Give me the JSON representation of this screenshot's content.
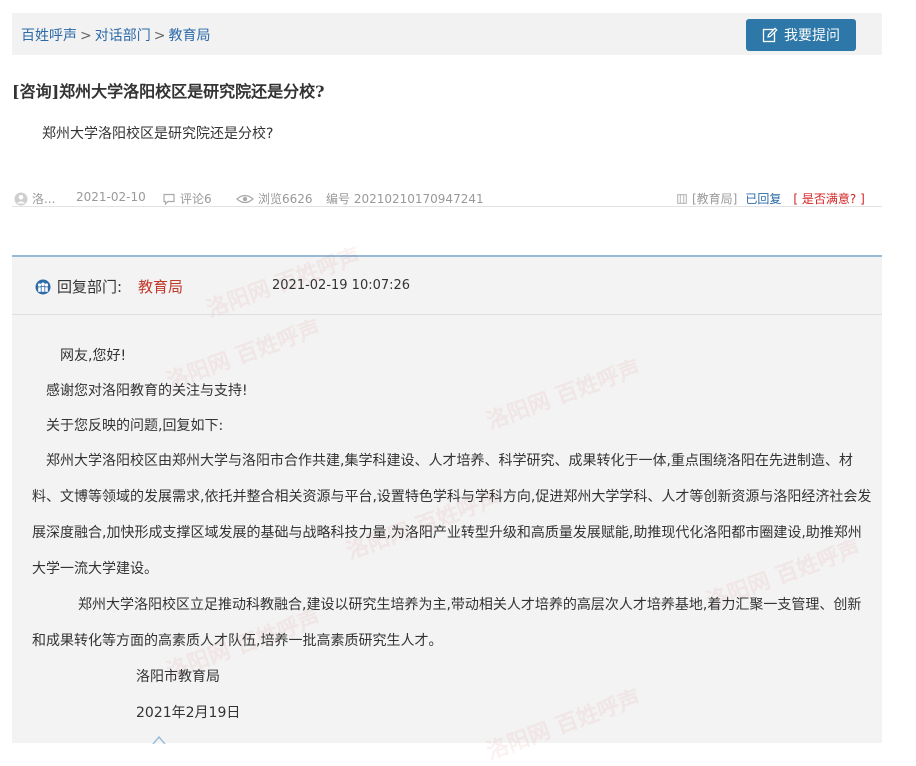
{
  "breadcrumb": {
    "items": [
      "百姓呼声",
      "对话部门",
      "教育局"
    ],
    "separator": ">"
  },
  "ask_button": {
    "label": "我要提问",
    "icon": "edit-icon"
  },
  "question": {
    "title": "[咨询]郑州大学洛阳校区是研究院还是分校?",
    "body": "郑州大学洛阳校区是研究院还是分校?"
  },
  "meta": {
    "author": "洛...",
    "date": "2021-02-10",
    "comments": "评论6",
    "views": "浏览6626",
    "number": "编号 20210210170947241",
    "department": "[教育局]",
    "status": "已回复",
    "satisfaction": "[ 是否满意? ]"
  },
  "reply": {
    "dept_label": "回复部门:",
    "dept_name": "教育局",
    "time": "2021-02-19 10:07:26",
    "greeting": "网友,您好!",
    "thanks": "感谢您对洛阳教育的关注与支持!",
    "intro": "关于您反映的问题,回复如下:",
    "para1": "郑州大学洛阳校区由郑州大学与洛阳市合作共建,集学科建设、人才培养、科学研究、成果转化于一体,重点围绕洛阳在先进制造、材料、文博等领域的发展需求,依托并整合相关资源与平台,设置特色学科与学科方向,促进郑州大学学科、人才等创新资源与洛阳经济社会发展深度融合,加快形成支撑区域发展的基础与战略科技力量,为洛阳产业转型升级和高质量发展赋能,助推现代化洛阳都市圈建设,助推郑州大学一流大学建设。",
    "para2": "郑州大学洛阳校区立足推动科教融合,建设以研究生培养为主,带动相关人才培养的高层次人才培养基地,着力汇聚一支管理、创新和成果转化等方面的高素质人才队伍,培养一批高素质研究生人才。",
    "signature": "洛阳市教育局",
    "sign_date": "2021年2月19日"
  },
  "watermark_text": "洛阳网 百姓呼声",
  "colors": {
    "link": "#2c6aa8",
    "button": "#2d78a9",
    "dept_name": "#c0392b",
    "satisfaction": "#d42222",
    "reply_border": "#97bad6"
  }
}
